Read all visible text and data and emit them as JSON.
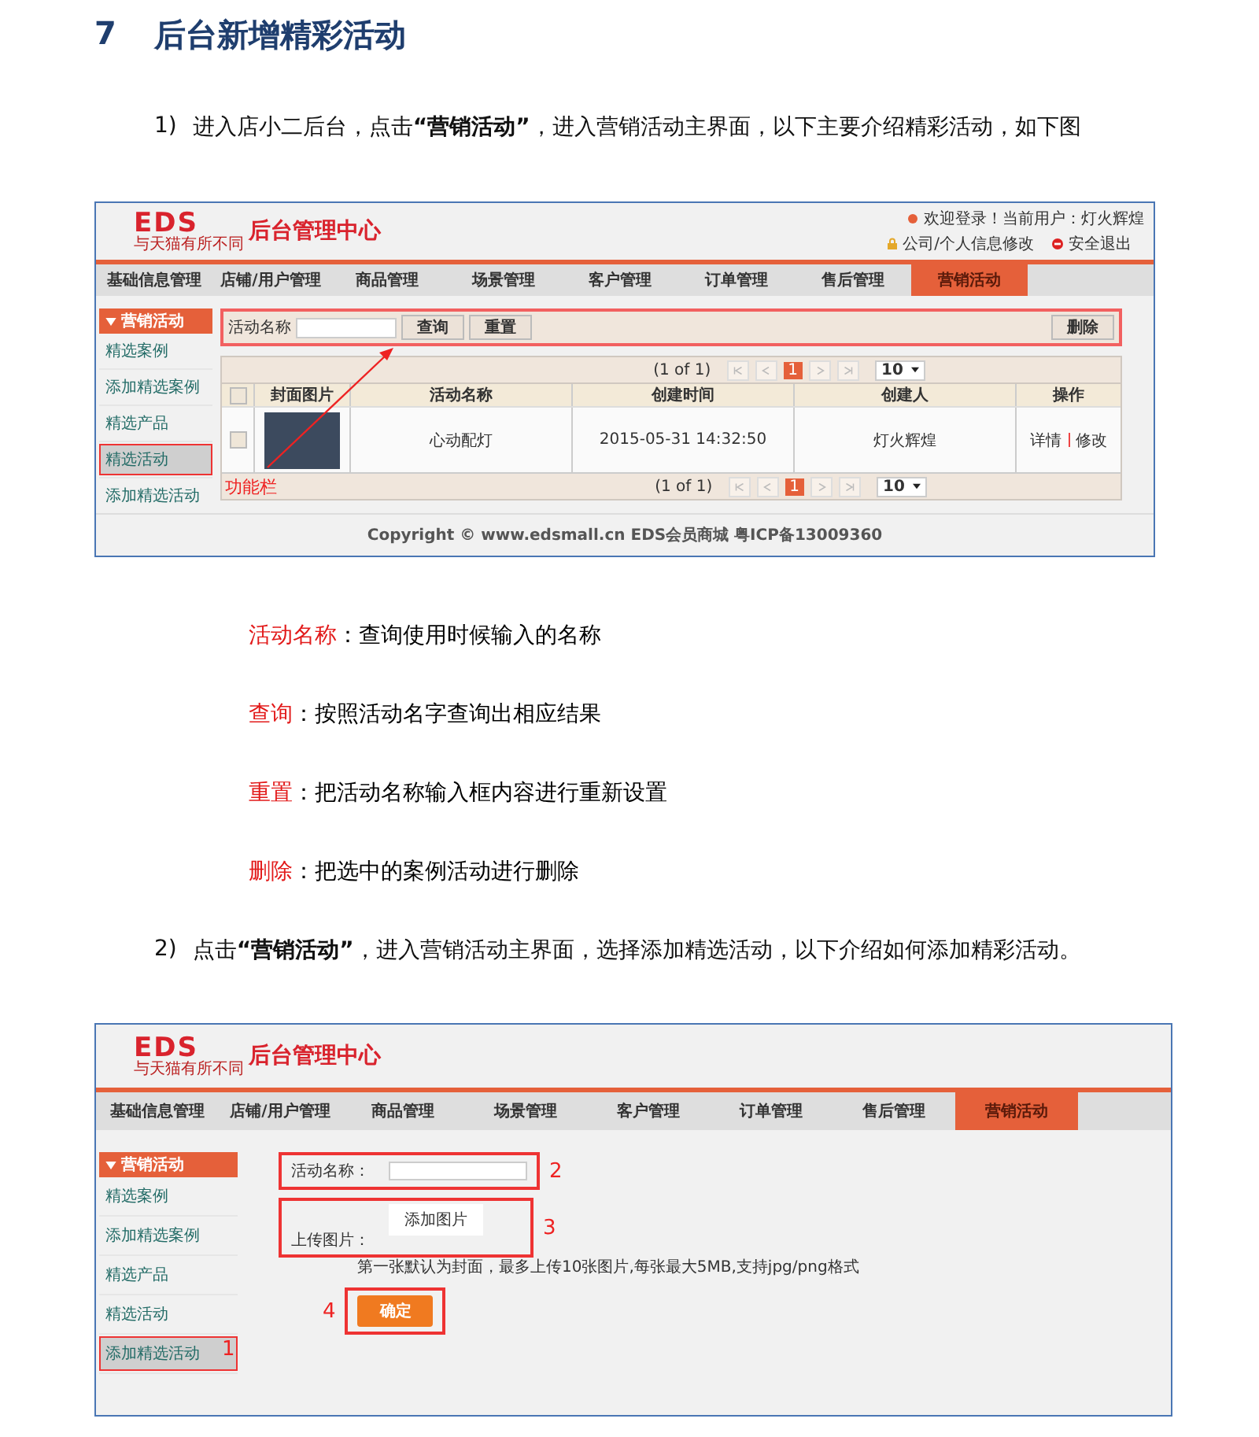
{
  "heading": {
    "number": "7",
    "title": "后台新增精彩活动"
  },
  "step1": {
    "number": "1)",
    "text": "进入店小二后台，点击**“营销活动”**，进入营销活动主界面，以下主要介绍精彩活动，如下图"
  },
  "screenshot1": {
    "logo": {
      "mark": "EDS",
      "tagline": "与天猫有所不同",
      "title": "后台管理中心"
    },
    "welcome": "欢迎登录！当前用户：灯火辉煌",
    "links": [
      "公司/个人信息修改",
      "安全退出"
    ],
    "nav": [
      {
        "label": "基础信息管理",
        "selected": false
      },
      {
        "label": "店铺/用户管理",
        "selected": false
      },
      {
        "label": "商品管理",
        "selected": false
      },
      {
        "label": "场景管理",
        "selected": false
      },
      {
        "label": "客户管理",
        "selected": false
      },
      {
        "label": "订单管理",
        "selected": false
      },
      {
        "label": "售后管理",
        "selected": false
      },
      {
        "label": "营销活动",
        "selected": true
      }
    ],
    "sidebar": {
      "header": "营销活动",
      "items": [
        {
          "label": "精选案例",
          "selected": false
        },
        {
          "label": "添加精选案例",
          "selected": false
        },
        {
          "label": "精选产品",
          "selected": false
        },
        {
          "label": "精选活动",
          "selected": true
        },
        {
          "label": "添加精选活动",
          "selected": false
        }
      ]
    },
    "toolbar": {
      "highlighted": true,
      "label": "活动名称",
      "buttons": [
        "查询",
        "重置"
      ],
      "delete_button": "删除"
    },
    "pagers": [
      {
        "info": "(1 of 1)",
        "page": "1",
        "page_size": "10"
      },
      {
        "info": "(1 of 1)",
        "page": "1",
        "page_size": "10"
      }
    ],
    "table": {
      "select_all_checked": false,
      "columns": [
        "封面图片",
        "活动名称",
        "创建时间",
        "创建人",
        "操作"
      ],
      "rows": [
        {
          "checked": false,
          "name": "心动配灯",
          "created": "2015-05-31 14:32:50",
          "creator": "灯火辉煌",
          "actions": [
            "详情",
            "修改"
          ]
        }
      ]
    },
    "annotation": "功能栏",
    "footer": "Copyright © www.edsmall.cn EDS会员商城 粤ICP备13009360"
  },
  "definitions": [
    {
      "term": "活动名称",
      "desc": "：查询使用时候输入的名称"
    },
    {
      "term": "查询",
      "desc": "：按照活动名字查询出相应结果"
    },
    {
      "term": "重置",
      "desc": "：把活动名称输入框内容进行重新设置"
    },
    {
      "term": "删除",
      "desc": "：把选中的案例活动进行删除"
    }
  ],
  "step2": {
    "number": "2)",
    "text": "点击**“营销活动”**，进入营销活动主界面，选择添加精选活动，以下介绍如何添加精彩活动。"
  },
  "screenshot2": {
    "logo": {
      "mark": "EDS",
      "tagline": "与天猫有所不同",
      "title": "后台管理中心"
    },
    "nav": [
      {
        "label": "基础信息管理",
        "selected": false
      },
      {
        "label": "店铺/用户管理",
        "selected": false
      },
      {
        "label": "商品管理",
        "selected": false
      },
      {
        "label": "场景管理",
        "selected": false
      },
      {
        "label": "客户管理",
        "selected": false
      },
      {
        "label": "订单管理",
        "selected": false
      },
      {
        "label": "售后管理",
        "selected": false
      },
      {
        "label": "营销活动",
        "selected": true
      }
    ],
    "sidebar": {
      "header": "营销活动",
      "items": [
        {
          "label": "精选案例",
          "selected": false
        },
        {
          "label": "添加精选案例",
          "selected": false
        },
        {
          "label": "精选产品",
          "selected": false
        },
        {
          "label": "精选活动",
          "selected": false
        },
        {
          "label": "添加精选活动",
          "selected": true,
          "marker": "1"
        }
      ]
    },
    "form": {
      "name_label": "活动名称：",
      "name_marker": "2",
      "upload_label": "上传图片：",
      "upload_button": "添加图片",
      "upload_marker": "3",
      "hint": "第一张默认为封面，最多上传10张图片,每张最大5MB,支持jpg/png格式",
      "submit_marker": "4",
      "submit": "确定"
    }
  }
}
